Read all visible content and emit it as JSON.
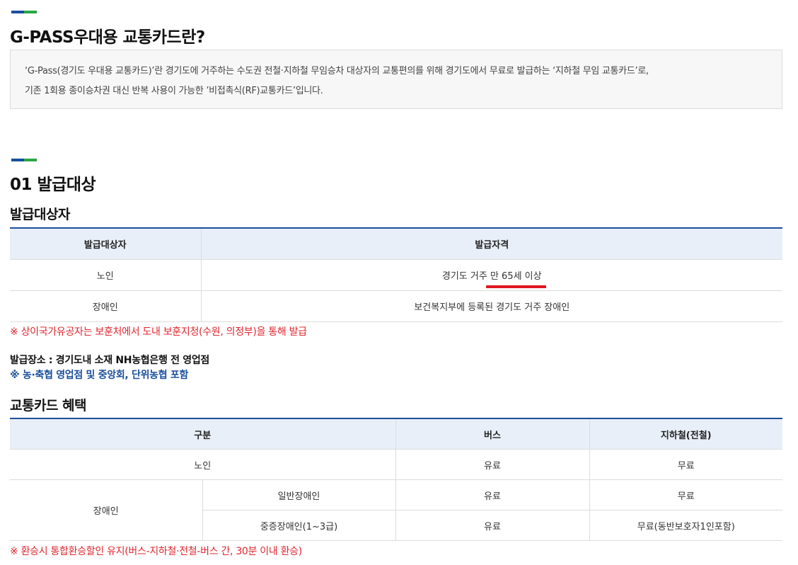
{
  "section_intro": {
    "title": "G-PASS우대용 교통카드란?",
    "line1": "‘G-Pass(경기도 우대용 교통카드)’란 경기도에 거주하는 수도권 전철·지하철 무임승차 대상자의 교통편의를 위해 경기도에서 무료로 발급하는 ‘지하철 무임 교통카드’로,",
    "line2": "기존 1회용 종이승차권 대신 반복 사용이 가능한 ’비접촉식(RF)교통카드’입니다."
  },
  "section_target": {
    "title": "01 발급대상",
    "subtitle": "발급대상자",
    "table": {
      "headers": [
        "발급대상자",
        "발급자격"
      ],
      "rows": [
        {
          "target": "노인",
          "qual_prefix": "경기도 거주 ",
          "qual_highlight": "만 65세 이상"
        },
        {
          "target": "장애인",
          "qual": "보건복지부에 등록된 경기도 거주 장애인"
        }
      ]
    },
    "note": "※ 상이국가유공자는 보훈처에서 도내 보훈지청(수원, 의정부)을 통해 발급",
    "place": "발급장소 : 경기도내 소재 NH농협은행 전 영업점",
    "place_note": "※ 농·축협 영업점 및 중앙회, 단위농협 포함"
  },
  "section_benefit": {
    "subtitle": "교통카드 혜택",
    "table": {
      "headers": [
        "구분",
        "버스",
        "지하철(전철)"
      ],
      "row_senior": {
        "category": "노인",
        "bus": "유료",
        "subway": "무료"
      },
      "disabled_category": "장애인",
      "row_general": {
        "sub": "일반장애인",
        "bus": "유료",
        "subway": "무료"
      },
      "row_severe": {
        "sub": "중증장애인(1~3급)",
        "bus": "유료",
        "subway": "무료(동반보호자1인포함)"
      }
    },
    "note": "※ 환승시 통합환승할인 유지(버스-지하철·전철-버스 간, 30분 이내 환승)"
  },
  "colors": {
    "accent_blue": "#1b4f9c",
    "accent_green": "#2aa745",
    "note_red": "#e0262e",
    "highlight_underline": "#e0161f",
    "table_header_bg": "#e8eff8"
  }
}
